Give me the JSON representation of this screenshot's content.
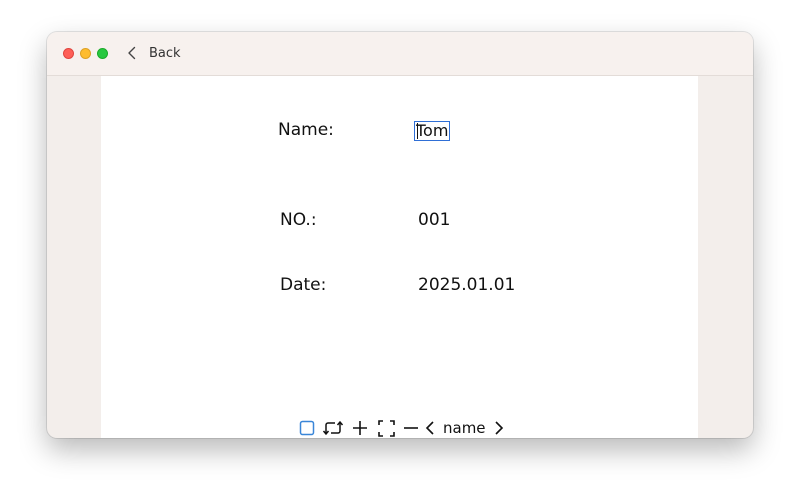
{
  "window": {
    "back_label": "Back"
  },
  "form": {
    "name_label": "Name:",
    "name_value": "Tom",
    "no_label": "NO.:",
    "no_value": "001",
    "date_label": "Date:",
    "date_value": "2025.01.01"
  },
  "toolbar": {
    "field_name": "name",
    "icons": [
      "checkbox-icon",
      "rotate-icon",
      "plus-icon",
      "fit-frame-icon",
      "minus-icon",
      "chevron-left-icon",
      "chevron-right-icon"
    ]
  },
  "colors": {
    "selection": "#2f6fd6",
    "checkbox_accent": "#3a86d8",
    "window_bg": "#f3eeeb"
  }
}
